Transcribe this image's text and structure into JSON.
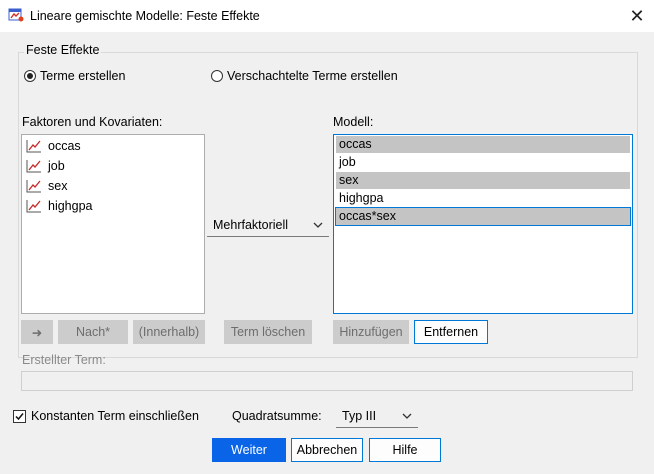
{
  "window": {
    "title": "Lineare gemischte Modelle: Feste Effekte",
    "close_label": "✕"
  },
  "group": {
    "legend": "Feste Effekte"
  },
  "radios": {
    "build_terms": "Terme erstellen",
    "nested_terms": "Verschachtelte Terme erstellen"
  },
  "factors": {
    "label": "Faktoren und Kovariaten:",
    "items": [
      "occas",
      "job",
      "sex",
      "highgpa"
    ]
  },
  "model": {
    "label": "Modell:",
    "items": [
      "occas",
      "job",
      "sex",
      "highgpa",
      "occas*sex"
    ],
    "selected": [
      true,
      false,
      true,
      false,
      true
    ]
  },
  "term_type": {
    "value": "Mehrfaktoriell"
  },
  "buttons": {
    "arrow": "➜",
    "by": "Nach*",
    "within": "(Innerhalb)",
    "clear_term": "Term löschen",
    "add": "Hinzufügen",
    "remove": "Entfernen",
    "continue": "Weiter",
    "cancel": "Abbrechen",
    "help": "Hilfe"
  },
  "built_term": {
    "label": "Erstellter Term:",
    "value": ""
  },
  "include_intercept": {
    "label": "Konstanten Term einschließen",
    "checked": true
  },
  "sum_of_squares": {
    "label": "Quadratsumme:",
    "value": "Typ III"
  }
}
